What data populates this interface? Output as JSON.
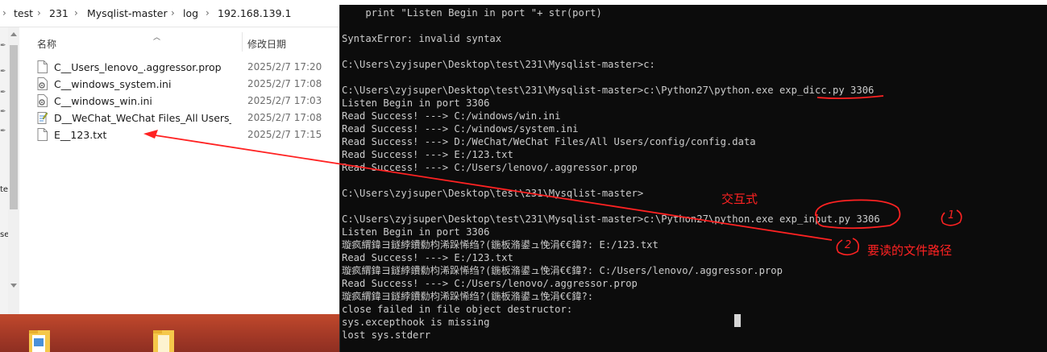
{
  "explorer": {
    "breadcrumb": [
      "test",
      "231",
      "Mysqlist-master",
      "log",
      "192.168.139.1"
    ],
    "columns": {
      "name": "名称",
      "date": "修改日期"
    },
    "files": [
      {
        "icon": "text-file-icon",
        "name": "C__Users_lenovo_.aggressor.prop",
        "date": "2025/2/7 17:20"
      },
      {
        "icon": "settings-file-icon",
        "name": "C__windows_system.ini",
        "date": "2025/2/7 17:08"
      },
      {
        "icon": "settings-file-icon",
        "name": "C__windows_win.ini",
        "date": "2025/2/7 17:03"
      },
      {
        "icon": "notepad-file-icon",
        "name": "D__WeChat_WeChat Files_All Users_c...",
        "date": "2025/2/7 17:08"
      },
      {
        "icon": "text-file-icon",
        "name": "E__123.txt",
        "date": "2025/2/7 17:15"
      }
    ],
    "nav_fragments": [
      "te",
      "se"
    ]
  },
  "terminal": {
    "lines": [
      "    print \"Listen Begin in port \"+ str(port)",
      "",
      "SyntaxError: invalid syntax",
      "",
      "C:\\Users\\zyjsuper\\Desktop\\test\\231\\Mysqlist-master>c:",
      "",
      "C:\\Users\\zyjsuper\\Desktop\\test\\231\\Mysqlist-master>c:\\Python27\\python.exe exp_dicc.py 3306",
      "Listen Begin in port 3306",
      "Read Success! ---> C:/windows/win.ini",
      "Read Success! ---> C:/windows/system.ini",
      "Read Success! ---> D:/WeChat/WeChat Files/All Users/config/config.data",
      "Read Success! ---> E:/123.txt",
      "Read Success! ---> C:/Users/lenovo/.aggressor.prop",
      "",
      "C:\\Users\\zyjsuper\\Desktop\\test\\231\\Mysqlist-master>",
      "",
      "C:\\Users\\zyjsuper\\Desktop\\test\\231\\Mysqlist-master>c:\\Python27\\python.exe exp_input.py 3306",
      "Listen Begin in port 3306",
      "璇疯緭鍏ヨ鐩綍鐨勬枃浠跺悕绉?(鍦板潃鍙ュ悗涓€€鍏?: E:/123.txt",
      "Read Success! ---> E:/123.txt",
      "璇疯緭鍏ヨ鐩綍鐨勬枃浠跺悕绉?(鍦板潃鍙ュ悗涓€€鍏?: C:/Users/lenovo/.aggressor.prop",
      "Read Success! ---> C:/Users/lenovo/.aggressor.prop",
      "璇疯緭鍏ヨ鐩綍鐨勬枃浠跺悕绉?(鍦板潃鍙ュ悗涓€€鍏?:",
      "close failed in file object destructor:",
      "sys.excepthook is missing",
      "lost sys.stderr"
    ]
  },
  "annotations": {
    "interactive_label": "交互式",
    "marker_1": "1",
    "marker_2": "2",
    "file_path_label": "要读的文件路径"
  },
  "colors": {
    "annotation": "#ff2222",
    "terminal_bg": "#0c0c0c",
    "terminal_text": "#cccccc",
    "desktop": "#b0432b"
  }
}
